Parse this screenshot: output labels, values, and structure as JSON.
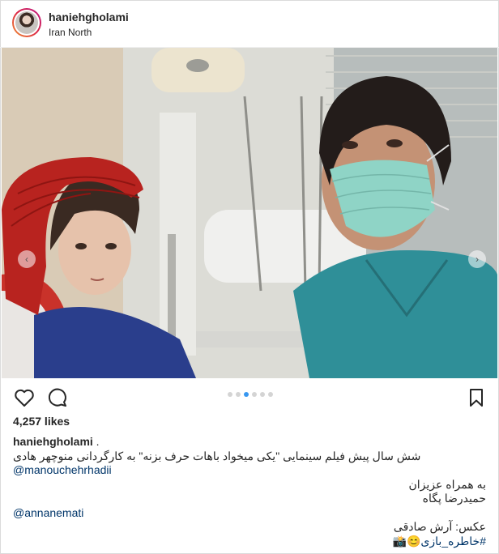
{
  "post": {
    "username": "haniehgholami",
    "location": "Iran North",
    "likes": "4,257 likes",
    "carousel": {
      "count": 6,
      "active_index": 2
    }
  },
  "caption": {
    "author": "haniehgholami",
    "author_suffix": " .",
    "line1": "شش سال پیش فیلم سینمایی \"یکی میخواد باهات حرف بزنه\" به کارگردانی منوچهر هادی",
    "mention1": "@manouchehrhadii",
    "line2": "به همراه عزیزان",
    "line3": "حمیدرضا پگاه",
    "mention2": "@annanemati",
    "line4": "عکس: آرش صادقی",
    "line5": "#خاطره_بازی😊📸"
  },
  "icons": {
    "like": "heart-icon",
    "comment": "comment-icon",
    "save": "bookmark-icon",
    "prev": "chevron-left-icon",
    "next": "chevron-right-icon"
  },
  "colors": {
    "text": "#262626",
    "link": "#003569",
    "active_dot": "#3897f0",
    "inactive_dot": "#d4d4d4",
    "border": "#dbdbdb"
  }
}
